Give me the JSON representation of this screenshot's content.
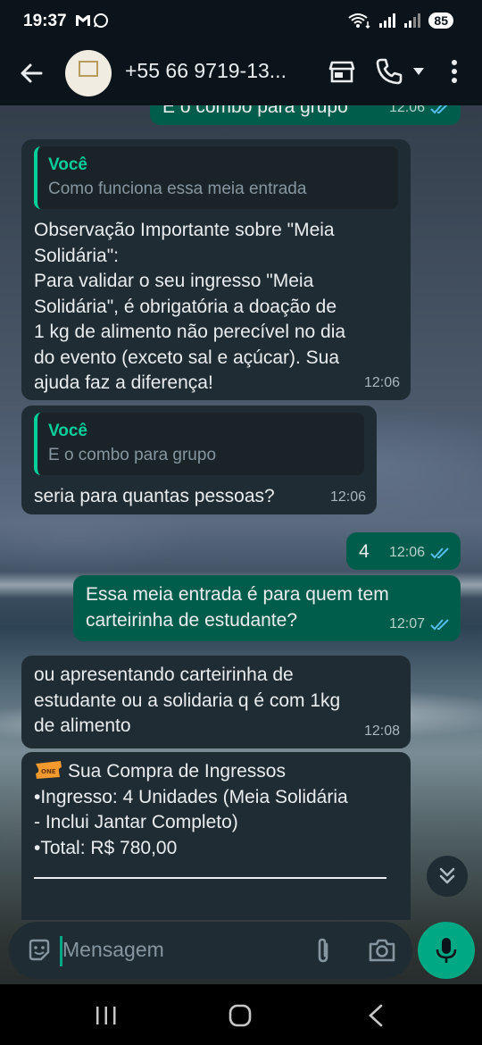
{
  "status_bar": {
    "time": "19:37",
    "battery": "85"
  },
  "header": {
    "contact_name": "+55 66 9719-13..."
  },
  "messages": [
    {
      "type": "out",
      "text": "E o combo para grupo",
      "time": "12:06",
      "ticks": "read"
    },
    {
      "type": "in",
      "quote_author": "Você",
      "quote_text": "Como funciona essa meia entrada",
      "lines": [
        "Observação Importante sobre \"Meia",
        "Solidária\":",
        "Para validar o seu ingresso \"Meia",
        "Solidária\", é obrigatória a doação de",
        "1 kg de alimento não perecível no dia",
        "do evento (exceto sal e açúcar). Sua",
        "ajuda faz a diferença!"
      ],
      "time": "12:06"
    },
    {
      "type": "in",
      "quote_author": "Você",
      "quote_text": "E o combo para grupo",
      "text": "seria para quantas pessoas?",
      "time": "12:06"
    },
    {
      "type": "out",
      "text": "4",
      "time": "12:06",
      "ticks": "read"
    },
    {
      "type": "out",
      "lines": [
        "Essa meia entrada é para quem tem",
        "carteirinha de estudante?"
      ],
      "time": "12:07",
      "ticks": "read"
    },
    {
      "type": "in",
      "lines": [
        "ou apresentando carteirinha de",
        "estudante ou a solidaria q é com 1kg",
        "de alimento"
      ],
      "time": "12:08"
    },
    {
      "type": "in",
      "title": "Sua Compra de Ingressos",
      "lines": [
        "•Ingresso: 4 Unidades (Meia Solidária",
        "- Inclui Jantar Completo)",
        "•Total: R$ 780,00"
      ]
    }
  ],
  "input": {
    "placeholder": "Mensagem"
  },
  "colors": {
    "incoming_bubble": "#1f2c34",
    "outgoing_bubble": "#005c4b",
    "accent": "#00a884",
    "quote_author": "#06cf9c",
    "read_ticks": "#53bdeb"
  },
  "icons": [
    "back-arrow-icon",
    "avatar",
    "store-icon",
    "phone-icon",
    "caret-down-icon",
    "more-vert-icon",
    "scroll-down-icon",
    "sticker-icon",
    "attach-icon",
    "camera-icon",
    "mic-icon",
    "ticket-icon"
  ]
}
